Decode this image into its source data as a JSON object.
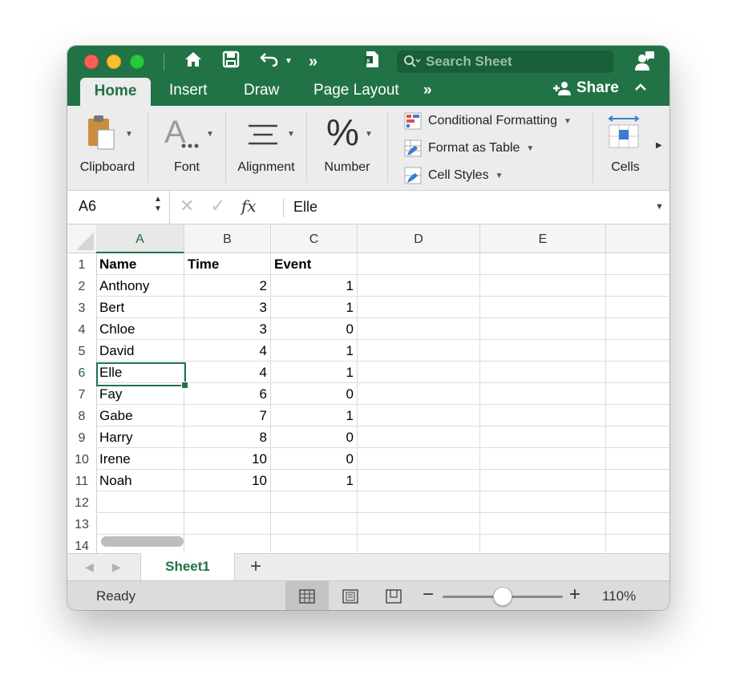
{
  "titlebar": {
    "search_placeholder": "Search Sheet",
    "colors": {
      "accent": "#217346",
      "close": "#fe5f57",
      "minimize": "#febc2e",
      "zoom": "#28c840"
    }
  },
  "tabs": [
    {
      "label": "Home",
      "active": true
    },
    {
      "label": "Insert"
    },
    {
      "label": "Draw"
    },
    {
      "label": "Page Layout"
    }
  ],
  "more_tabs": "»",
  "share_label": "Share",
  "ribbon": {
    "clipboard": "Clipboard",
    "font": "Font",
    "alignment": "Alignment",
    "number": "Number",
    "number_glyph": "%",
    "conditional_formatting": "Conditional Formatting",
    "format_as_table": "Format as Table",
    "cell_styles": "Cell Styles",
    "cells": "Cells"
  },
  "formula_bar": {
    "name_box": "A6",
    "fx": "fx",
    "value": "Elle"
  },
  "sheet": {
    "columns": [
      "A",
      "B",
      "C",
      "D",
      "E"
    ],
    "rows": [
      {
        "num": "1",
        "cells": [
          "Name",
          "Time",
          "Event",
          "",
          ""
        ]
      },
      {
        "num": "2",
        "cells": [
          "Anthony",
          "2",
          "1",
          "",
          ""
        ]
      },
      {
        "num": "3",
        "cells": [
          "Bert",
          "3",
          "1",
          "",
          ""
        ]
      },
      {
        "num": "4",
        "cells": [
          "Chloe",
          "3",
          "0",
          "",
          ""
        ]
      },
      {
        "num": "5",
        "cells": [
          "David",
          "4",
          "1",
          "",
          ""
        ]
      },
      {
        "num": "6",
        "cells": [
          "Elle",
          "4",
          "1",
          "",
          ""
        ]
      },
      {
        "num": "7",
        "cells": [
          "Fay",
          "6",
          "0",
          "",
          ""
        ]
      },
      {
        "num": "8",
        "cells": [
          "Gabe",
          "7",
          "1",
          "",
          ""
        ]
      },
      {
        "num": "9",
        "cells": [
          "Harry",
          "8",
          "0",
          "",
          ""
        ]
      },
      {
        "num": "10",
        "cells": [
          "Irene",
          "10",
          "0",
          "",
          ""
        ]
      },
      {
        "num": "11",
        "cells": [
          "Noah",
          "10",
          "1",
          "",
          ""
        ]
      },
      {
        "num": "12",
        "cells": [
          "",
          "",
          "",
          "",
          ""
        ]
      },
      {
        "num": "13",
        "cells": [
          "",
          "",
          "",
          "",
          ""
        ]
      },
      {
        "num": "14",
        "cells": [
          "",
          "",
          "",
          "",
          ""
        ]
      }
    ],
    "selected_cell": "A6",
    "sheet_tab": "Sheet1",
    "add_sheet": "+"
  },
  "status": {
    "text": "Ready",
    "zoom_minus": "−",
    "zoom_plus": "+",
    "zoom": "110%",
    "zoom_level": 0.5
  }
}
